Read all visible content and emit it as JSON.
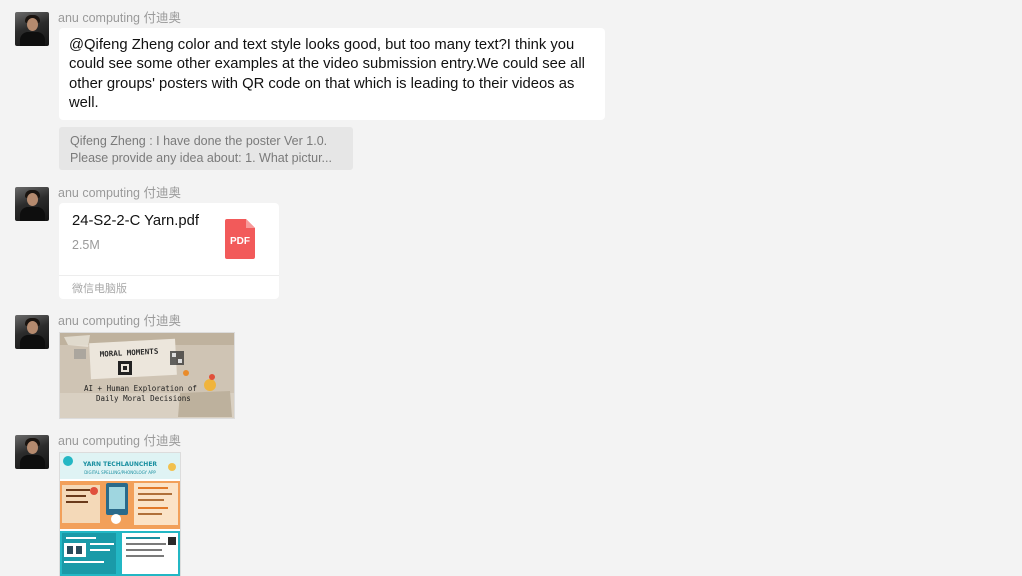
{
  "messages": [
    {
      "sender": "anu computing 付迪奥",
      "text": "@Qifeng Zheng color and text style looks good, but too many text?I think you could see some other examples at the video submission entry.We could see all other groups' posters with QR code on that which is leading to their videos as well.",
      "quote": {
        "line1": "Qifeng Zheng : I have done the poster Ver 1.0.",
        "line2": "Please provide any idea about: 1. What pictur..."
      }
    },
    {
      "sender": "anu computing 付迪奥",
      "file": {
        "name": "24-S2-2-C Yarn.pdf",
        "size": "2.5M",
        "icon_label": "PDF",
        "icon": "pdf-file-icon",
        "source": "微信电脑版"
      }
    },
    {
      "sender": "anu computing 付迪奥",
      "image": {
        "kind": "poster-thumbnail",
        "texts": [
          "MORAL MOMENTS",
          "AI + Human Exploration of",
          "Daily Moral Decisions"
        ]
      }
    },
    {
      "sender": "anu computing 付迪奥",
      "image": {
        "kind": "poster-thumbnail",
        "texts": [
          "YARN TECHLAUNCHER",
          "DIGITAL SPELLING/PHONOLOGY APP"
        ]
      }
    }
  ],
  "colors": {
    "background": "#f3f3f3",
    "bubble": "#ffffff",
    "pdf_red": "#f25a5a",
    "poster_teal": "#23b7c4",
    "poster_orange": "#f2a05a"
  }
}
